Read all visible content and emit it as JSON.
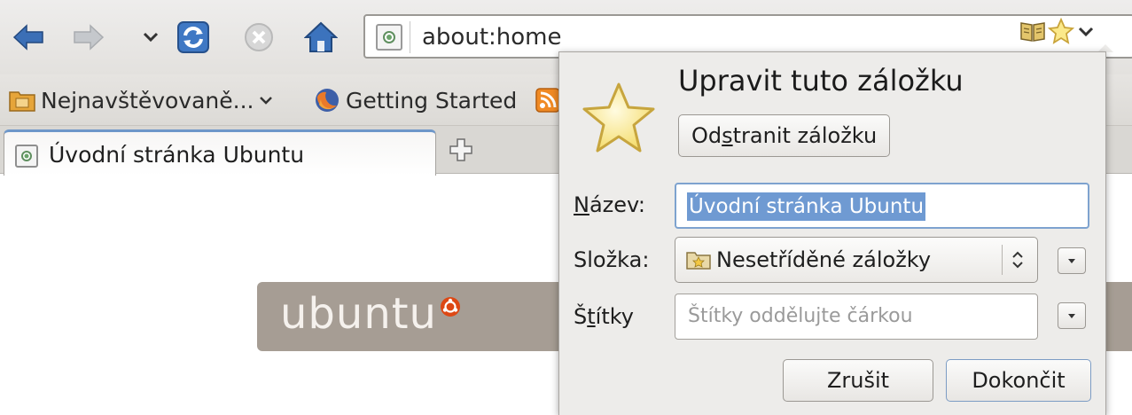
{
  "navbar": {
    "url": "about:home"
  },
  "bookmarks_toolbar": {
    "items": [
      {
        "label": "Nejnavštěvovaně...",
        "icon": "folder-icon"
      },
      {
        "label": "Getting Started",
        "icon": "firefox-icon"
      }
    ]
  },
  "tabs": [
    {
      "label": "Úvodní stránka Ubuntu",
      "active": true
    }
  ],
  "page": {
    "banner_text": "ubuntu"
  },
  "bookmark_panel": {
    "title": "Upravit tuto záložku",
    "remove_button": {
      "before": "Od",
      "underlined": "s",
      "after": "tranit záložku"
    },
    "name_label": {
      "underlined": "N",
      "rest": "ázev:"
    },
    "name_value": "Úvodní stránka Ubuntu",
    "folder_label": "Složka:",
    "folder_value": "Nesetříděné záložky",
    "tags_label": {
      "before": "Š",
      "underlined": "t",
      "after": "ítky"
    },
    "tags_placeholder": "Štítky oddělujte čárkou",
    "cancel_label": "Zrušit",
    "done_label": "Dokončit"
  },
  "colors": {
    "accent_selection": "#6f9ad2",
    "ubuntu_banner": "#a69d94",
    "ubuntu_orange": "#dd4814"
  }
}
